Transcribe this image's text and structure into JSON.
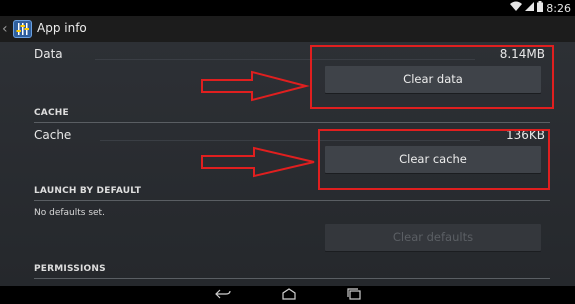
{
  "status_bar": {
    "time": "8:26",
    "icons": [
      "wifi-icon",
      "signal-icon",
      "battery-icon"
    ]
  },
  "action_bar": {
    "title": "App info",
    "icons": [
      "up-chevron-icon",
      "app-icon"
    ]
  },
  "storage": {
    "data_label": "Data",
    "data_value": "8.14MB",
    "clear_data_button": "Clear data"
  },
  "cache": {
    "section_title": "CACHE",
    "cache_label": "Cache",
    "cache_value": "136KB",
    "clear_cache_button": "Clear cache"
  },
  "launch_by_default": {
    "section_title": "LAUNCH BY DEFAULT",
    "description": "No defaults set.",
    "clear_defaults_button": "Clear defaults"
  },
  "permissions": {
    "section_title": "PERMISSIONS"
  },
  "navigation_bar": {
    "icons": [
      "back-icon",
      "home-icon",
      "recent-apps-icon"
    ]
  },
  "colors": {
    "highlight": "#e01f1f",
    "background": "#2b2e33",
    "button": "#3f4349"
  }
}
